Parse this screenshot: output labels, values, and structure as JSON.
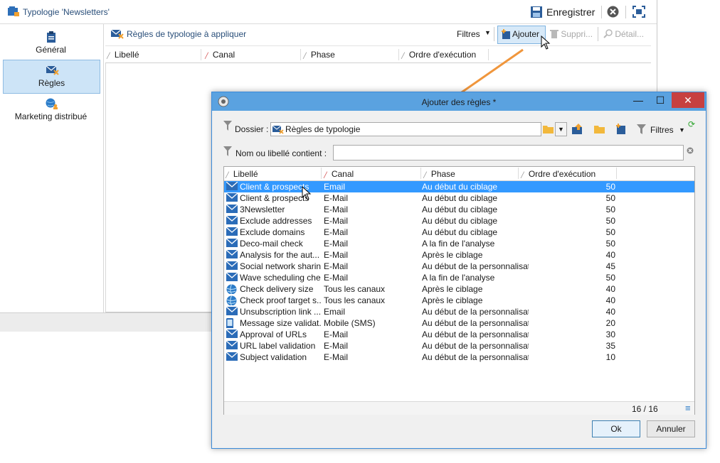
{
  "background_window": {
    "title": "Typologie 'Newsletters'",
    "save_label": "Enregistrer",
    "sidebar": [
      {
        "label": "Général",
        "icon": "clipboard-icon"
      },
      {
        "label": "Règles",
        "icon": "rules-icon"
      },
      {
        "label": "Marketing distribué",
        "icon": "globe-user-icon"
      }
    ],
    "section_title": "Règles de typologie à appliquer",
    "toolbar": {
      "filters": "Filtres",
      "add": "Ajouter",
      "delete": "Suppri...",
      "detail": "Détail..."
    },
    "columns": [
      "Libellé",
      "Canal",
      "Phase",
      "Ordre d'exécution"
    ]
  },
  "dialog": {
    "title": "Ajouter des règles *",
    "folder_label": "Dossier :",
    "folder_value": "Règles de typologie",
    "filters_label": "Filtres",
    "name_label": "Nom ou libellé contient :",
    "name_value": "",
    "columns": [
      "Libellé",
      "Canal",
      "Phase",
      "Ordre d'exécution"
    ],
    "rows": [
      {
        "label": "Client & prospects",
        "channel": "Email",
        "phase": "Au début du ciblage",
        "order": "50",
        "icon": "mail"
      },
      {
        "label": "Client & prospects",
        "channel": "E-Mail",
        "phase": "Au début du ciblage",
        "order": "50",
        "icon": "mail"
      },
      {
        "label": "3Newsletter",
        "channel": "E-Mail",
        "phase": "Au début du ciblage",
        "order": "50",
        "icon": "mail"
      },
      {
        "label": "Exclude addresses",
        "channel": "E-Mail",
        "phase": "Au début du ciblage",
        "order": "50",
        "icon": "mail"
      },
      {
        "label": "Exclude domains",
        "channel": "E-Mail",
        "phase": "Au début du ciblage",
        "order": "50",
        "icon": "mail"
      },
      {
        "label": "Deco-mail check",
        "channel": "E-Mail",
        "phase": "A la fin de l'analyse",
        "order": "50",
        "icon": "mail"
      },
      {
        "label": "Analysis for the aut...",
        "channel": "E-Mail",
        "phase": "Après le ciblage",
        "order": "40",
        "icon": "mail"
      },
      {
        "label": "Social network sharin...",
        "channel": "E-Mail",
        "phase": "Au début de la personnalisation",
        "order": "45",
        "icon": "mail"
      },
      {
        "label": "Wave scheduling che...",
        "channel": "E-Mail",
        "phase": "A la fin de l'analyse",
        "order": "50",
        "icon": "mail"
      },
      {
        "label": "Check delivery size",
        "channel": "Tous les canaux",
        "phase": "Après le ciblage",
        "order": "40",
        "icon": "globe"
      },
      {
        "label": "Check proof target s...",
        "channel": "Tous les canaux",
        "phase": "Après le ciblage",
        "order": "40",
        "icon": "globe"
      },
      {
        "label": "Unsubscription link ...",
        "channel": "Email",
        "phase": "Au début de la personnalisation",
        "order": "40",
        "icon": "mail"
      },
      {
        "label": "Message size validat...",
        "channel": "Mobile (SMS)",
        "phase": "Au début de la personnalisation",
        "order": "20",
        "icon": "phone"
      },
      {
        "label": "Approval of URLs",
        "channel": "E-Mail",
        "phase": "Au début de la personnalisation",
        "order": "30",
        "icon": "mail"
      },
      {
        "label": "URL label validation",
        "channel": "E-Mail",
        "phase": "Au début de la personnalisation",
        "order": "35",
        "icon": "mail"
      },
      {
        "label": "Subject validation",
        "channel": "E-Mail",
        "phase": "Au début de la personnalisation",
        "order": "10",
        "icon": "mail"
      }
    ],
    "count": "16 / 16",
    "ok_label": "Ok",
    "cancel_label": "Annuler"
  },
  "colors": {
    "selection": "#3399ff",
    "titlebar": "#5aa2e0",
    "close": "#c74040",
    "arrow": "#f0963c"
  }
}
